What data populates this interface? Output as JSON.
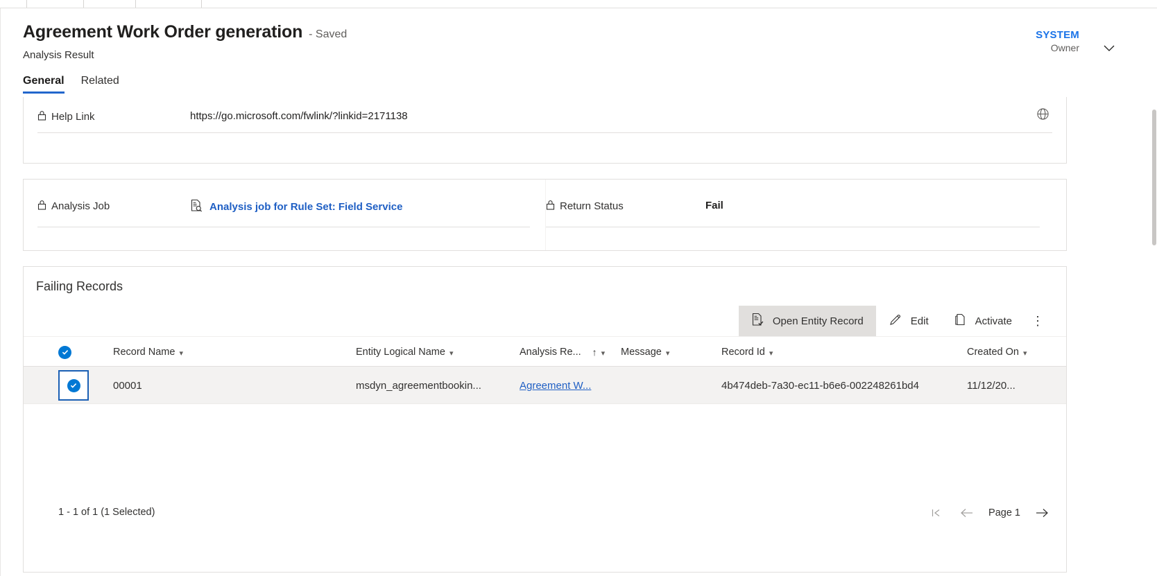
{
  "header": {
    "title": "Agreement Work Order generation",
    "saved_state": "- Saved",
    "entity_name": "Analysis Result",
    "owner_name": "SYSTEM",
    "owner_label": "Owner"
  },
  "tabs": [
    {
      "label": "General",
      "active": true
    },
    {
      "label": "Related",
      "active": false
    }
  ],
  "help_section": {
    "label": "Help Link",
    "value": "https://go.microsoft.com/fwlink/?linkid=2171138"
  },
  "job_section": {
    "analysis_job_label": "Analysis Job",
    "analysis_job_value": "Analysis job for Rule Set: Field Service",
    "return_status_label": "Return Status",
    "return_status_value": "Fail"
  },
  "subgrid": {
    "heading": "Failing Records",
    "commands": [
      {
        "label": "Open Entity Record",
        "icon": "open-entity-record-icon",
        "highlighted": true
      },
      {
        "label": "Edit",
        "icon": "pencil-icon",
        "highlighted": false
      },
      {
        "label": "Activate",
        "icon": "activate-page-icon",
        "highlighted": false
      }
    ],
    "overflow_label": "⋮",
    "columns": [
      {
        "label": "Record Name",
        "sorted": false
      },
      {
        "label": "Entity Logical Name",
        "sorted": false
      },
      {
        "label": "Analysis Re...",
        "sorted": true,
        "sort_direction": "↑"
      },
      {
        "label": "Message",
        "sorted": false
      },
      {
        "label": "Record Id",
        "sorted": false
      },
      {
        "label": "Created On",
        "sorted": false
      }
    ],
    "rows": [
      {
        "record_name": "00001",
        "entity_logical_name": "msdyn_agreementbookin...",
        "analysis_result": "Agreement W...",
        "message": "",
        "record_id": "4b474deb-7a30-ec11-b6e6-002248261bd4",
        "created_on": "11/12/20...",
        "selected": true
      }
    ],
    "footer_count": "1 - 1 of 1 (1 Selected)",
    "page_label": "Page 1"
  },
  "colors": {
    "accent": "#0078d4",
    "link": "#1f5fc4",
    "tab_underline": "#2266cc",
    "row_selected_bg": "#f3f2f1"
  }
}
